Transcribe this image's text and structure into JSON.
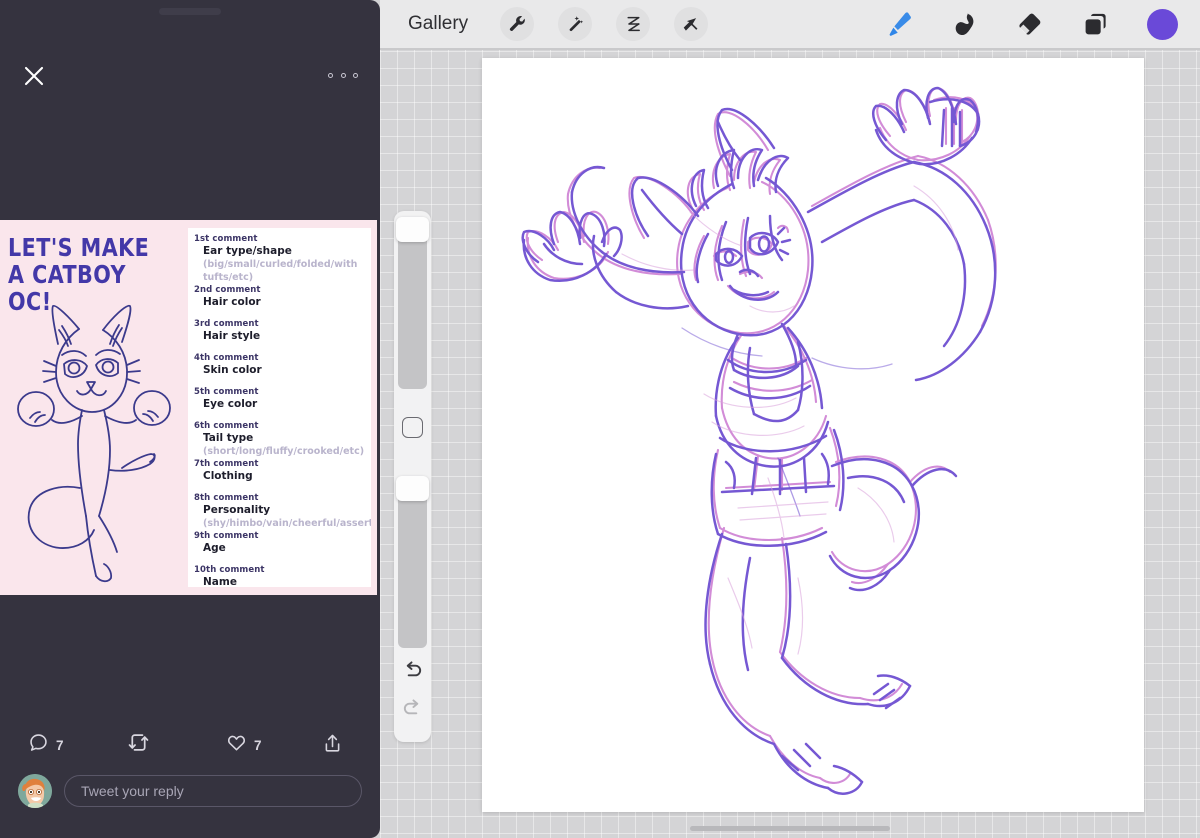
{
  "twitter": {
    "close_icon": "close-icon",
    "more_icon": "more-horizontal-icon",
    "embedded_image": {
      "title": "LET'S MAKE A CATBOY OC!",
      "background_color": "#fae6ec",
      "title_color": "#4338a8",
      "sketch_color": "#3b3a8c",
      "prompts": [
        {
          "order": "1st comment",
          "label": "Ear type/shape",
          "hint": "(big/small/curled/folded/with tufts/etc)"
        },
        {
          "order": "2nd comment",
          "label": "Hair color",
          "hint": ""
        },
        {
          "order": "3rd comment",
          "label": "Hair style",
          "hint": ""
        },
        {
          "order": "4th comment",
          "label": "Skin color",
          "hint": ""
        },
        {
          "order": "5th comment",
          "label": "Eye color",
          "hint": ""
        },
        {
          "order": "6th comment",
          "label": "Tail type",
          "hint": "(short/long/fluffy/crooked/etc)"
        },
        {
          "order": "7th comment",
          "label": "Clothing",
          "hint": ""
        },
        {
          "order": "8th comment",
          "label": "Personality",
          "hint": "(shy/himbo/vain/cheerful/assertive/etc)"
        },
        {
          "order": "9th comment",
          "label": "Age",
          "hint": ""
        },
        {
          "order": "10th comment",
          "label": "Name",
          "hint": ""
        }
      ]
    },
    "actions": {
      "reply_icon": "comment-icon",
      "reply_count": "7",
      "retweet_icon": "retweet-icon",
      "retweet_count": "",
      "like_icon": "heart-icon",
      "like_count": "7",
      "share_icon": "share-icon"
    },
    "reply_box": {
      "avatar": "user-avatar",
      "placeholder": "Tweet your reply",
      "value": ""
    }
  },
  "procreate": {
    "toolbar": {
      "gallery_label": "Gallery",
      "left_tools": [
        {
          "name": "wrench-icon",
          "label": "Actions"
        },
        {
          "name": "magic-wand-icon",
          "label": "Adjustments"
        },
        {
          "name": "selection-icon",
          "label": "Selection"
        },
        {
          "name": "arrow-transform-icon",
          "label": "Transform"
        }
      ],
      "right_tools": [
        {
          "name": "paintbrush-icon",
          "label": "Paint",
          "active": true,
          "color": "#2f86e8"
        },
        {
          "name": "smudge-icon",
          "label": "Smudge",
          "active": false,
          "color": "#2b2b2f"
        },
        {
          "name": "eraser-icon",
          "label": "Erase",
          "active": false,
          "color": "#2b2b2f"
        },
        {
          "name": "layers-icon",
          "label": "Layers",
          "active": false,
          "color": "#2b2b2f"
        }
      ],
      "color_swatch": "#6a49d8"
    },
    "sidebar": {
      "brush_size_label": "Brush size",
      "brush_size_knob_position": "top",
      "opacity_label": "Opacity",
      "opacity_knob_position": "top",
      "modify_button": "modify-button",
      "undo_icon": "undo-icon",
      "redo_icon": "redo-icon",
      "redo_disabled": true
    },
    "canvas": {
      "background": "#ffffff",
      "artwork_description": "Rough sketch of a jumping catboy character",
      "ink_colors": [
        "#7b52c8",
        "#c060c0",
        "#5a48c8"
      ]
    },
    "workspace_background": "#d4d4d6"
  }
}
